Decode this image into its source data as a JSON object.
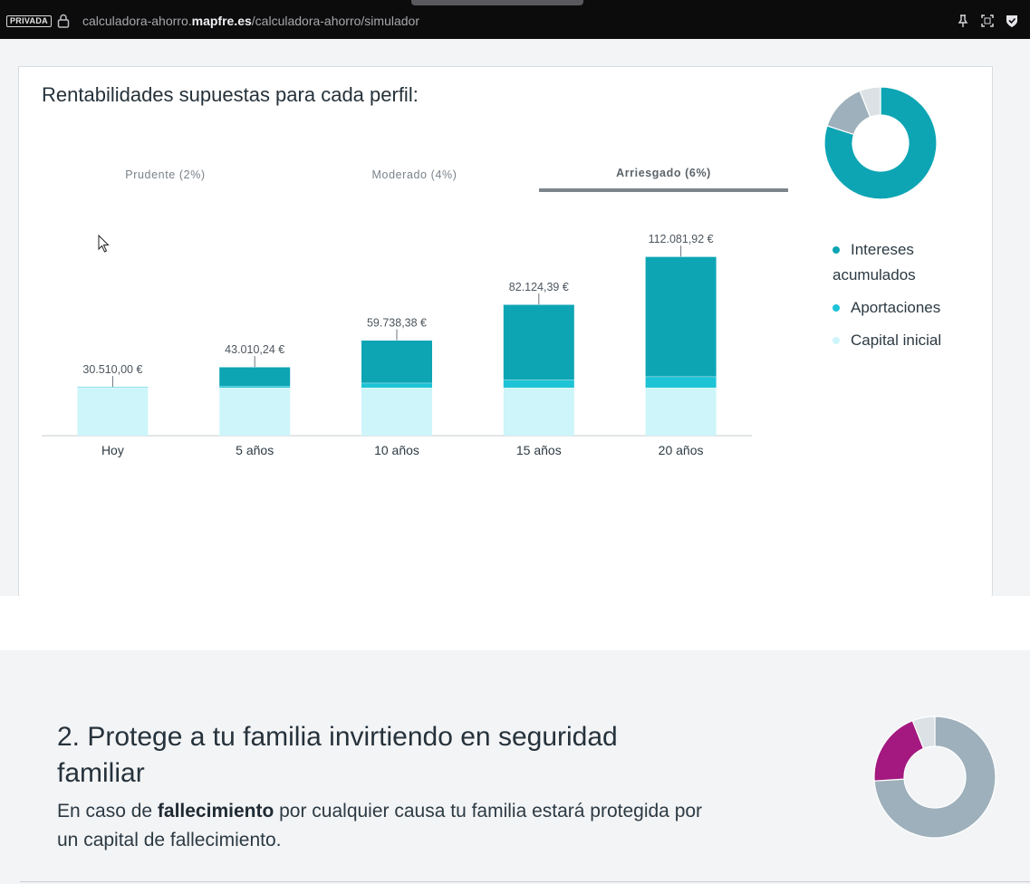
{
  "browser": {
    "private_label": "PRIVADA",
    "url_pre": "calculadora-ahorro.",
    "url_domain": "mapfre.es",
    "url_post": "/calculadora-ahorro/simulador"
  },
  "section1": {
    "title": "Rentabilidades supuestas para cada perfil:",
    "tabs": [
      {
        "label": "Prudente (2%)",
        "active": false
      },
      {
        "label": "Moderado (4%)",
        "active": false
      },
      {
        "label": "Arriesgado (6%)",
        "active": true
      }
    ],
    "legend": [
      {
        "label": "Intereses acumulados",
        "color": "#0da5b4"
      },
      {
        "label": "Aportaciones",
        "color": "#1ec3d6"
      },
      {
        "label": "Capital inicial",
        "color": "#cdf5fa"
      }
    ]
  },
  "chart_data": [
    {
      "type": "bar",
      "stacked": true,
      "categories": [
        "Hoy",
        "5 años",
        "10 años",
        "15 años",
        "20 años"
      ],
      "totals_labels": [
        "30.510,00 €",
        "43.010,24 €",
        "59.738,38 €",
        "82.124,39 €",
        "112.081,92 €"
      ],
      "series": [
        {
          "name": "Capital inicial",
          "color": "#cdf5fa",
          "values": [
            30000,
            30000,
            30000,
            30000,
            30000
          ]
        },
        {
          "name": "Aportaciones",
          "color": "#1ec3d6",
          "values": [
            510,
            1000,
            3000,
            5000,
            7000
          ]
        },
        {
          "name": "Intereses acumulados",
          "color": "#0da5b4",
          "values": [
            0,
            12010.24,
            26738.38,
            47124.39,
            75081.92
          ]
        }
      ]
    },
    {
      "type": "pie",
      "donut": true,
      "slices": [
        {
          "name": "Intereses acumulados",
          "color": "#0da5b4",
          "value": 0.8
        },
        {
          "name": "Aportaciones",
          "color": "#9eb0bb",
          "value": 0.14
        },
        {
          "name": "Capital inicial",
          "color": "#dbe1e5",
          "value": 0.06
        }
      ]
    },
    {
      "type": "pie",
      "donut": true,
      "slices": [
        {
          "color": "#9eb0bb",
          "value": 0.74
        },
        {
          "color": "#a3197f",
          "value": 0.2
        },
        {
          "color": "#dbe1e5",
          "value": 0.06
        }
      ]
    }
  ],
  "section2": {
    "title": "2. Protege a tu familia invirtiendo en seguridad familiar",
    "text_pre": "En caso de ",
    "text_bold": "fallecimiento",
    "text_post": " por cualquier causa tu familia estará protegida por un capital de fallecimiento."
  }
}
